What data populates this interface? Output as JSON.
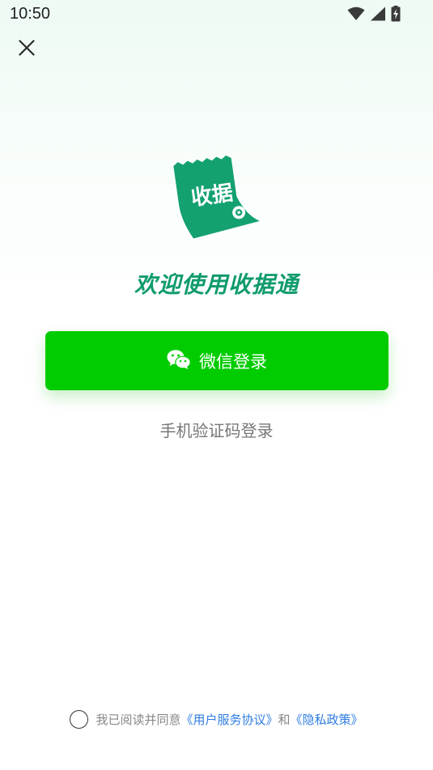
{
  "status_bar": {
    "time": "10:50",
    "icons": [
      "wifi-icon",
      "cell-signal-icon",
      "battery-charging-icon"
    ]
  },
  "close_icon": "close-icon",
  "logo": {
    "text": "收据",
    "colors": {
      "tag": "#13a170",
      "text": "#ffffff"
    }
  },
  "welcome_title": "欢迎使用收据通",
  "wechat_login": {
    "label": "微信登录",
    "icon": "wechat-icon"
  },
  "sms_login": {
    "label": "手机验证码登录"
  },
  "agreement": {
    "prefix": "我已阅读并同意",
    "user_agreement": "《用户服务协议》",
    "conjunction": "和",
    "privacy_policy": "《隐私政策》"
  },
  "colors": {
    "accent_green": "#00cc00",
    "brand_green": "#0f9b6d",
    "link_blue": "#2f7de1"
  }
}
